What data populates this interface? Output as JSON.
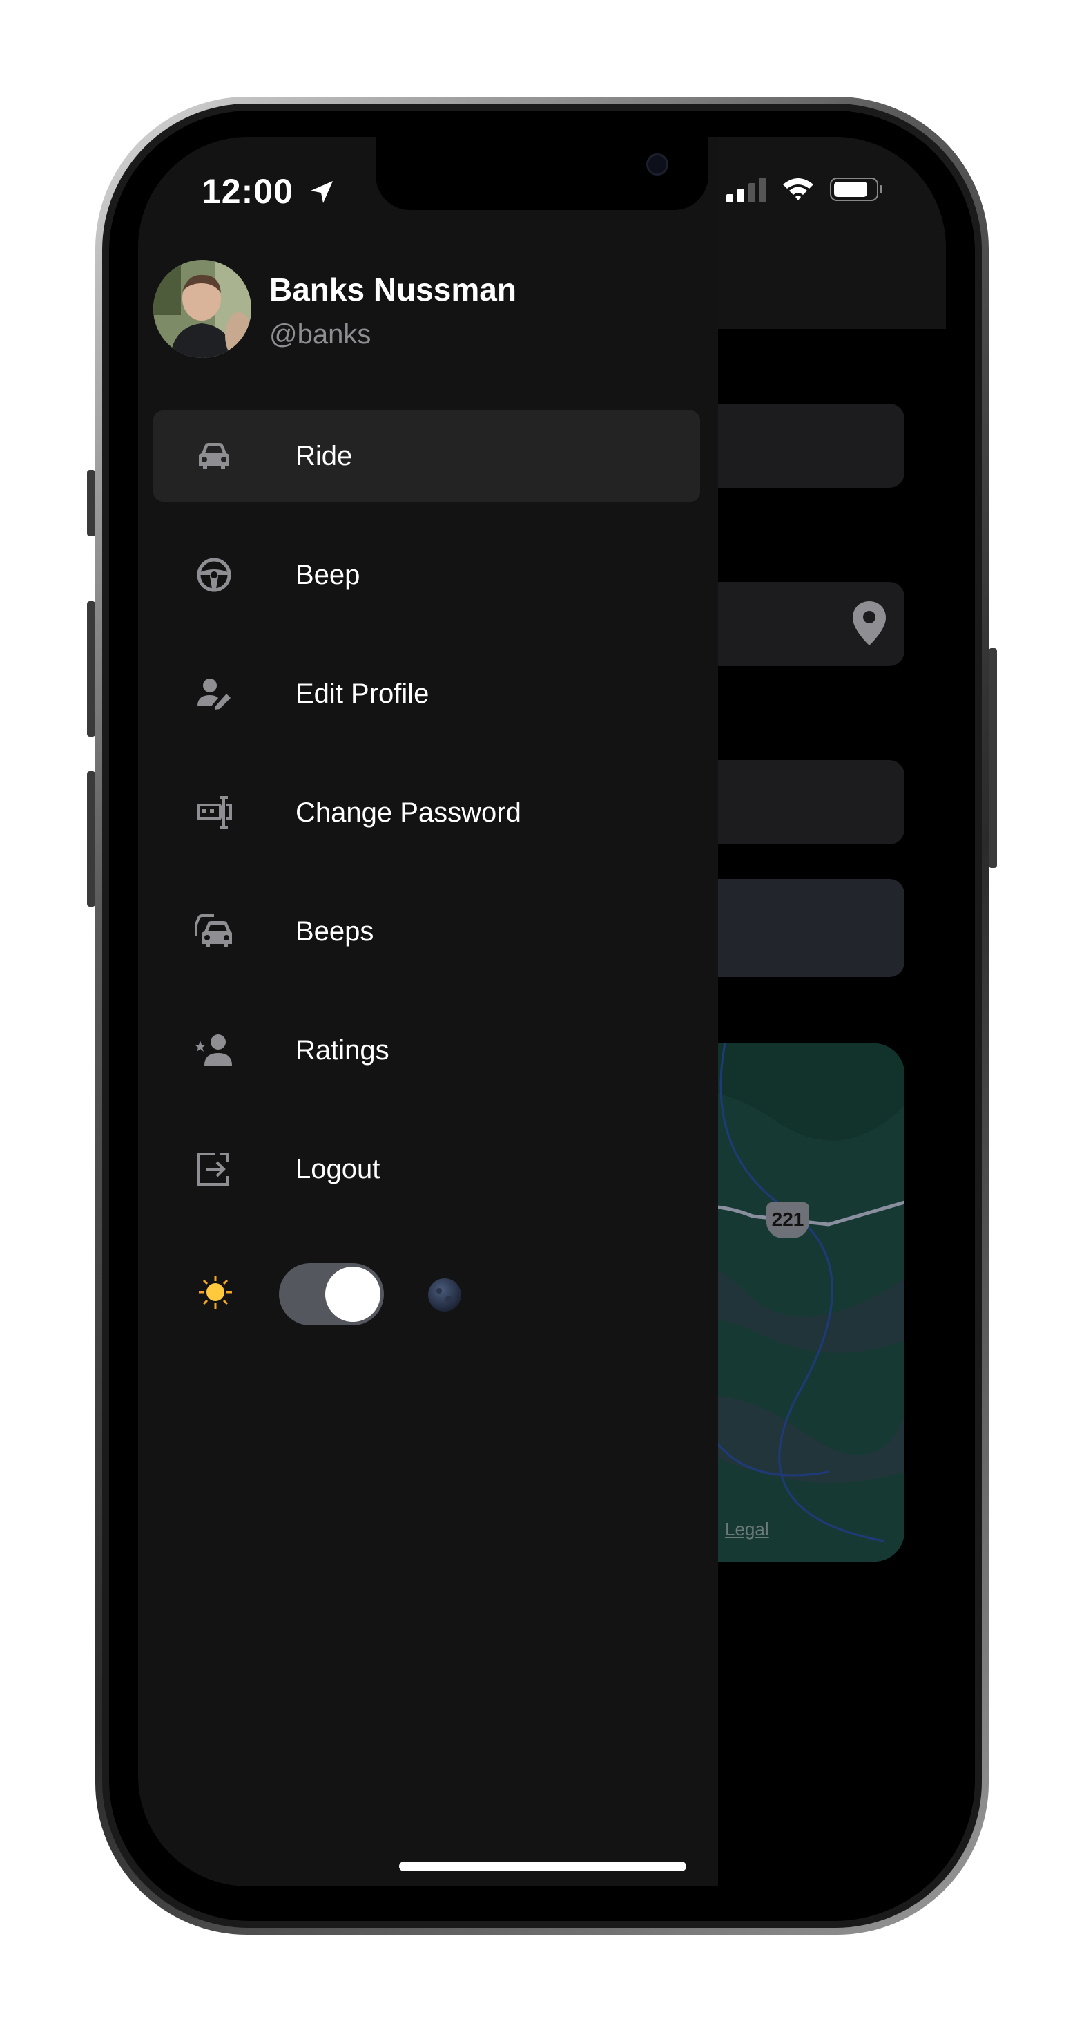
{
  "status_bar": {
    "time": "12:00"
  },
  "profile": {
    "name": "Banks Nussman",
    "handle": "@banks"
  },
  "menu": [
    {
      "label": "Ride",
      "icon": "car-icon",
      "active": true
    },
    {
      "label": "Beep",
      "icon": "steering-wheel-icon",
      "active": false
    },
    {
      "label": "Edit Profile",
      "icon": "user-edit-icon",
      "active": false
    },
    {
      "label": "Change Password",
      "icon": "password-icon",
      "active": false
    },
    {
      "label": "Beeps",
      "icon": "cars-icon",
      "active": false
    },
    {
      "label": "Ratings",
      "icon": "user-star-icon",
      "active": false
    },
    {
      "label": "Logout",
      "icon": "logout-icon",
      "active": false
    }
  ],
  "theme_toggle": {
    "light_icon": "sun-icon",
    "dark_icon": "moon-icon",
    "state": "dark"
  },
  "background": {
    "map_road_label": "221",
    "map_legal": "Legal"
  },
  "colors": {
    "drawer_bg": "#131313",
    "active_item_bg": "#232323",
    "text": "#ffffff",
    "muted": "#8e8e93"
  }
}
